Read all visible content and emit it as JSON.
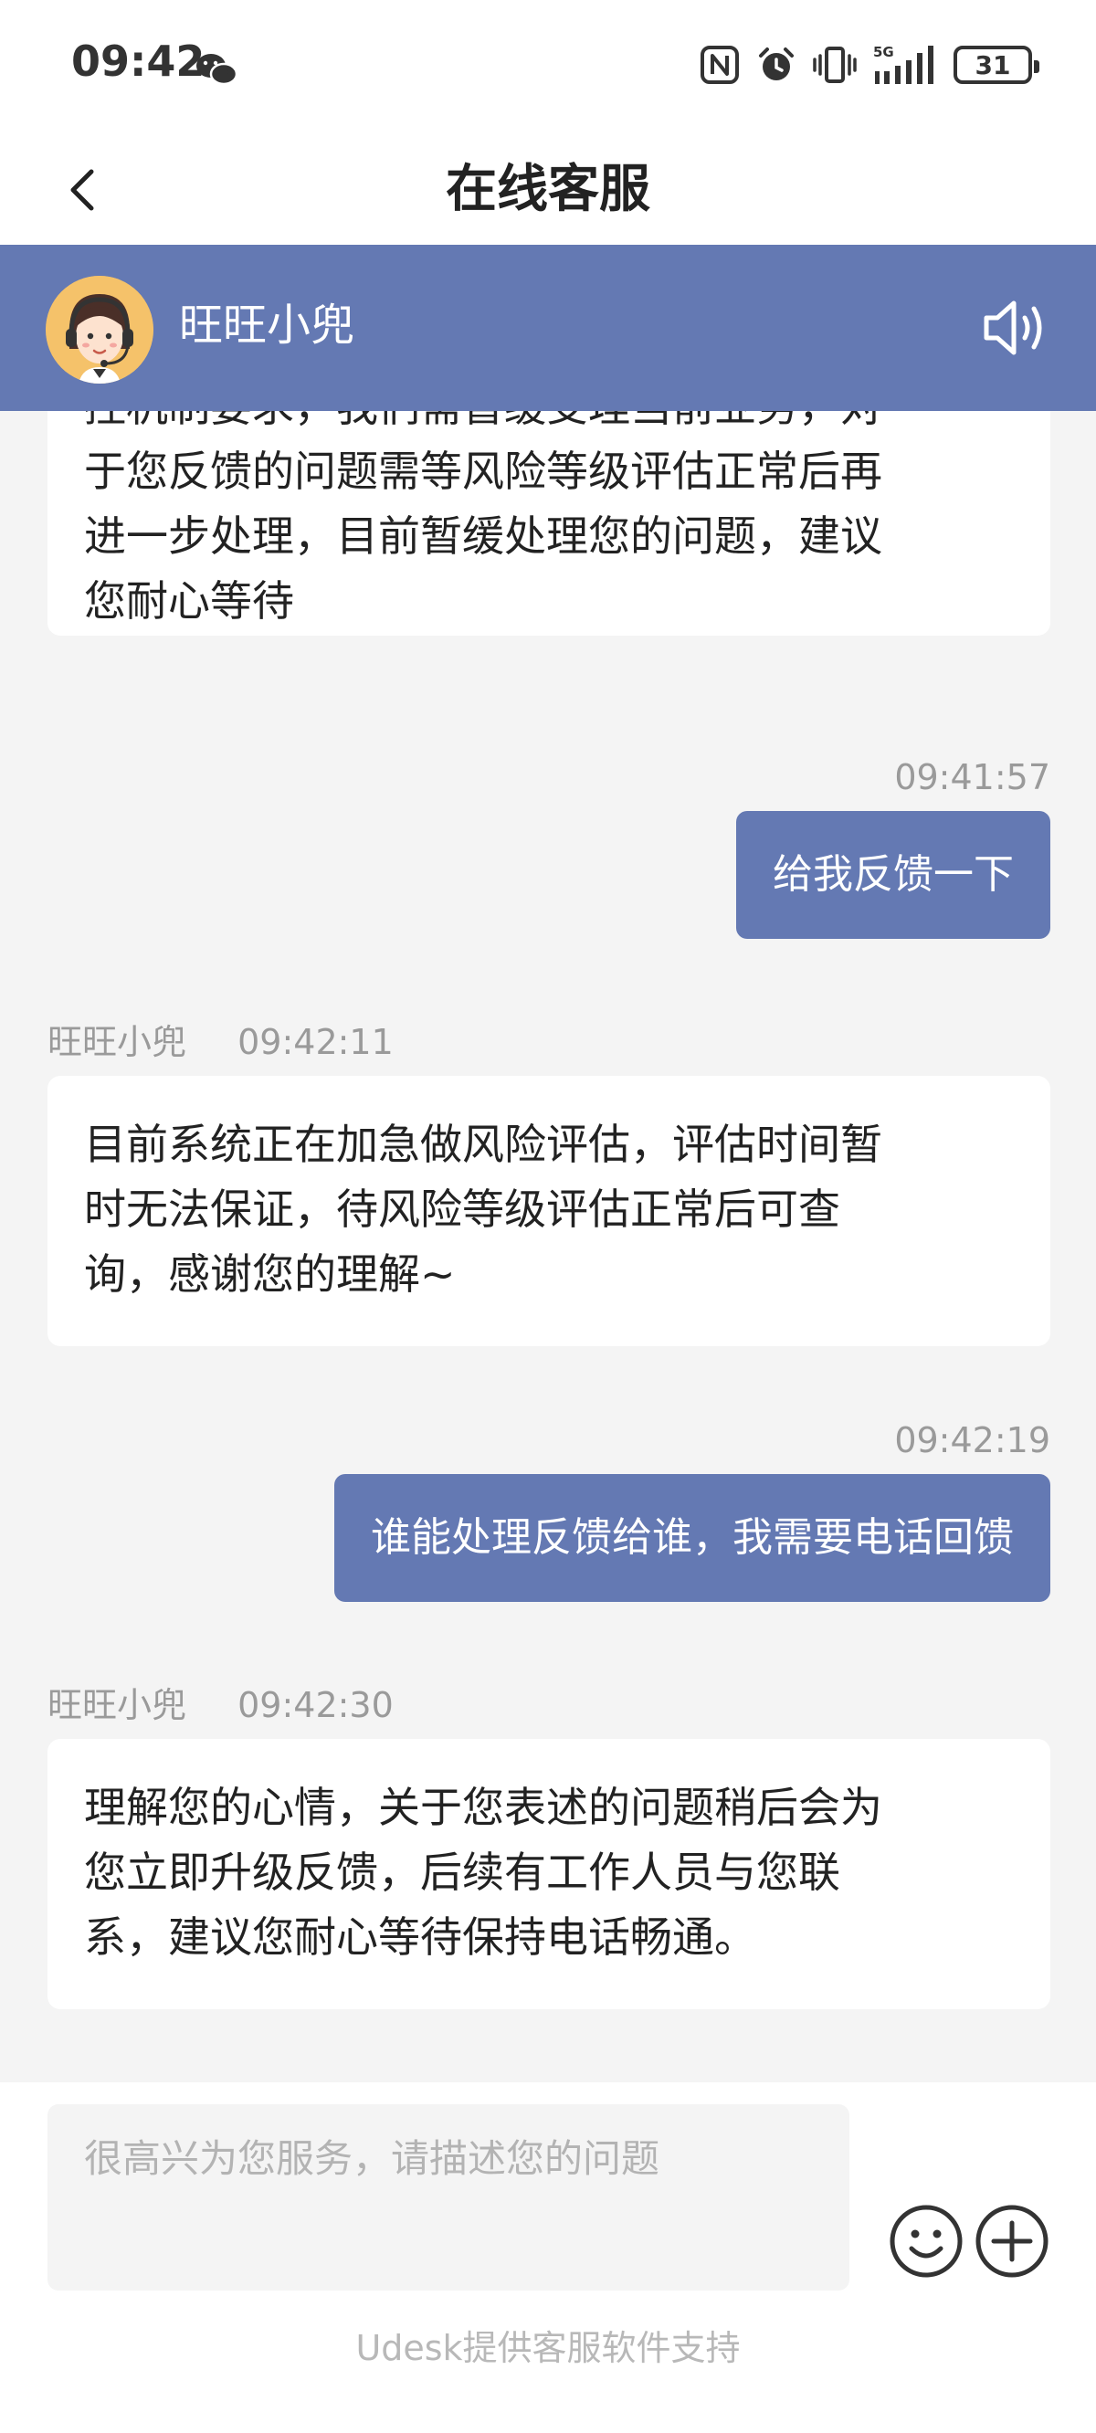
{
  "status_bar": {
    "time": "09:42",
    "battery": "31",
    "network": "5G"
  },
  "nav": {
    "title": "在线客服"
  },
  "agent": {
    "name": "旺旺小兜"
  },
  "messages": [
    {
      "direction": "in",
      "text_lines": [
        "控机制要求，我们需暂缓受理当前业务，对",
        "于您反馈的问题需等风险等级评估正常后再",
        "进一步处理，目前暂缓处理您的问题，建议",
        "您耐心等待"
      ]
    },
    {
      "direction": "out",
      "time": "09:41:57",
      "text": "给我反馈一下"
    },
    {
      "direction": "in",
      "sender": "旺旺小兜",
      "time": "09:42:11",
      "text_lines": [
        "目前系统正在加急做风险评估，评估时间暂",
        "时无法保证，待风险等级评估正常后可查",
        "询，感谢您的理解~"
      ]
    },
    {
      "direction": "out",
      "time": "09:42:19",
      "text": "谁能处理反馈给谁，我需要电话回馈"
    },
    {
      "direction": "in",
      "sender": "旺旺小兜",
      "time": "09:42:30",
      "text_lines": [
        "理解您的心情，关于您表述的问题稍后会为",
        "您立即升级反馈，后续有工作人员与您联",
        "系，建议您耐心等待保持电话畅通。"
      ]
    }
  ],
  "input": {
    "placeholder": "很高兴为您服务，请描述您的问题",
    "value": ""
  },
  "footer": {
    "credit": "Udesk提供客服软件支持"
  },
  "icons": {
    "back": "chevron-left-icon",
    "speaker": "speaker-icon",
    "emoji": "smiley-icon",
    "plus": "plus-circle-icon",
    "wechat": "wechat-icon",
    "nfc": "nfc-icon",
    "alarm": "alarm-icon",
    "vibrate": "vibrate-icon",
    "signal": "signal-icon"
  },
  "colors": {
    "accent": "#6479b3",
    "background": "#f4f4f4",
    "meta_text": "#9a9a9a"
  }
}
